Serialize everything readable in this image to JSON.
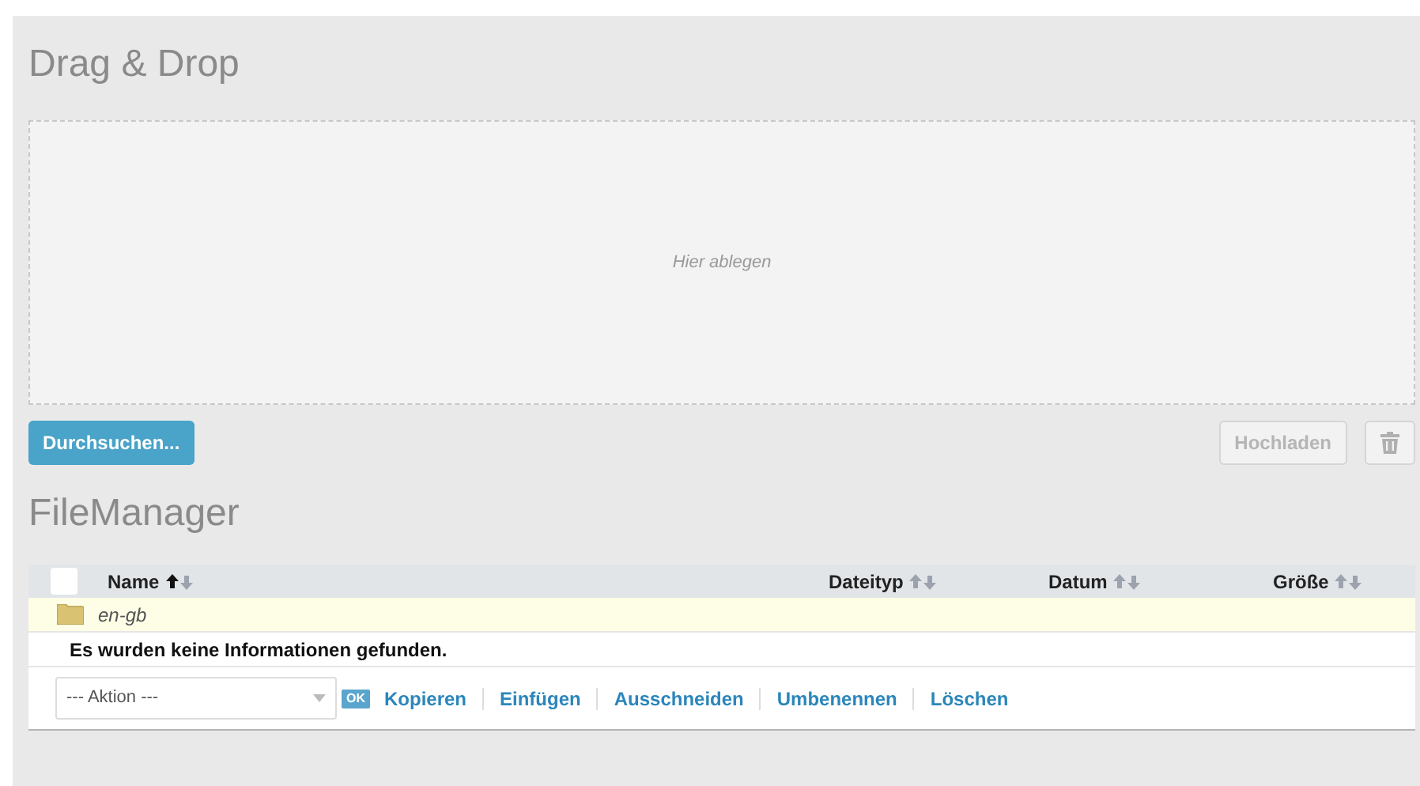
{
  "upload": {
    "title": "Drag & Drop",
    "dropzone_hint": "Hier ablegen",
    "browse_button": "Durchsuchen...",
    "upload_button": {
      "label": "Hochladen",
      "disabled": true
    }
  },
  "file_manager": {
    "title": "FileManager",
    "select_all_checked": false,
    "columns": [
      {
        "label": "Name",
        "sorted_ascending": true
      },
      {
        "label": "Dateityp",
        "sorted_ascending": false
      },
      {
        "label": "Datum",
        "sorted_ascending": false
      },
      {
        "label": "Größe",
        "sorted_ascending": false
      }
    ],
    "rows": [
      {
        "name": "en-gb",
        "kind": "folder"
      }
    ],
    "empty_message": "Es wurden keine Informationen gefunden.",
    "action_select": {
      "value": "--- Aktion ---"
    },
    "ok_button": "OK",
    "actions": [
      "Kopieren",
      "Einfügen",
      "Ausschneiden",
      "Umbenennen",
      "Löschen"
    ]
  }
}
